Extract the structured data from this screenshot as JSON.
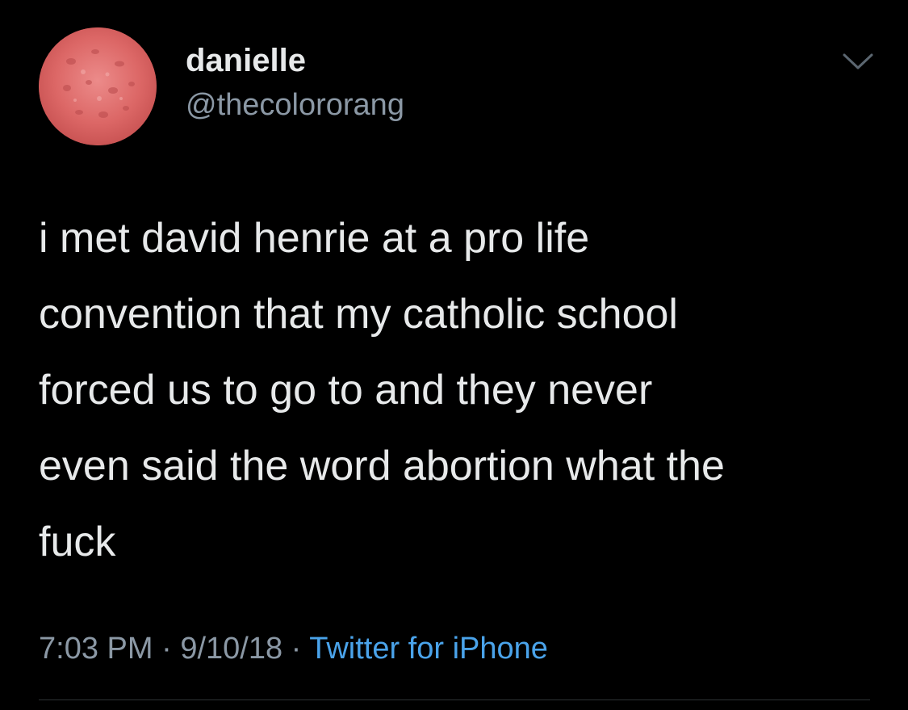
{
  "author": {
    "display_name": "danielle",
    "handle": "@thecolororang",
    "avatar_icon": "watermelon-avatar-icon"
  },
  "tweet": {
    "text": "i met david henrie at a pro life\nconvention that my catholic school\nforced us to go to and they never\neven said the word abortion what the\nfuck"
  },
  "meta": {
    "time": "7:03 PM",
    "separator": "·",
    "date": "9/10/18",
    "source": "Twitter for iPhone"
  },
  "colors": {
    "background": "#000000",
    "text": "#e7e9ea",
    "muted": "#8b98a5",
    "link": "#4aa3ea"
  },
  "icons": {
    "menu": "chevron-down-icon"
  }
}
